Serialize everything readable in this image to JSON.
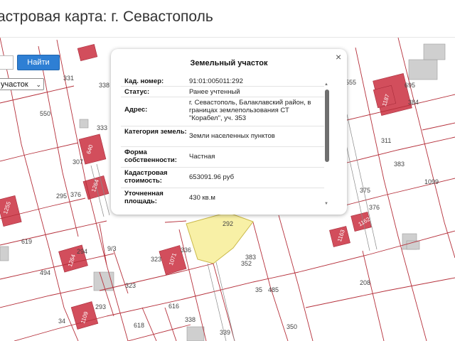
{
  "page": {
    "title": "астровая карта: г. Севастополь"
  },
  "search": {
    "button_label": "Найти",
    "input_value": "",
    "select_value": "участок"
  },
  "popup": {
    "title": "Земельный участок",
    "close_icon": "close-icon",
    "rows": [
      {
        "key": "Кад. номер:",
        "value": "91:01:005011:292"
      },
      {
        "key": "Статус:",
        "value": "Ранее учтенный"
      },
      {
        "key": "Адрес:",
        "value": "г. Севастополь, Балаклавский район, в границах землепользования СТ \"Корабел\", уч. 353"
      },
      {
        "key": "Категория земель:",
        "value": "Земли населенных пунктов"
      },
      {
        "key": "Форма собственности:",
        "value": "Частная"
      },
      {
        "key": "Кадастровая стоимость:",
        "value": "653091.96 руб"
      },
      {
        "key": "Уточненная площадь:",
        "value": "430 кв.м"
      }
    ]
  },
  "map": {
    "labels": [
      "331",
      "338",
      "550",
      "307",
      "333",
      "376",
      "295",
      "619",
      "294",
      "9/3",
      "494",
      "323",
      "336",
      "323",
      "293",
      "616",
      "338",
      "34",
      "618",
      "339",
      "292",
      "383",
      "352",
      "35",
      "485",
      "350",
      "555",
      "695",
      "384",
      "311",
      "383",
      "1099",
      "375",
      "376",
      "208",
      "1255",
      "640",
      "1264",
      "1264",
      "1071",
      "1163",
      "1162",
      "1109",
      "1187"
    ],
    "colors": {
      "parcel_line": "#b52f3a",
      "building": "#d24e5c",
      "building_gray": "#cfcfcf",
      "selected_parcel": "#f8f0a6",
      "accent": "#2e7fd4"
    }
  }
}
